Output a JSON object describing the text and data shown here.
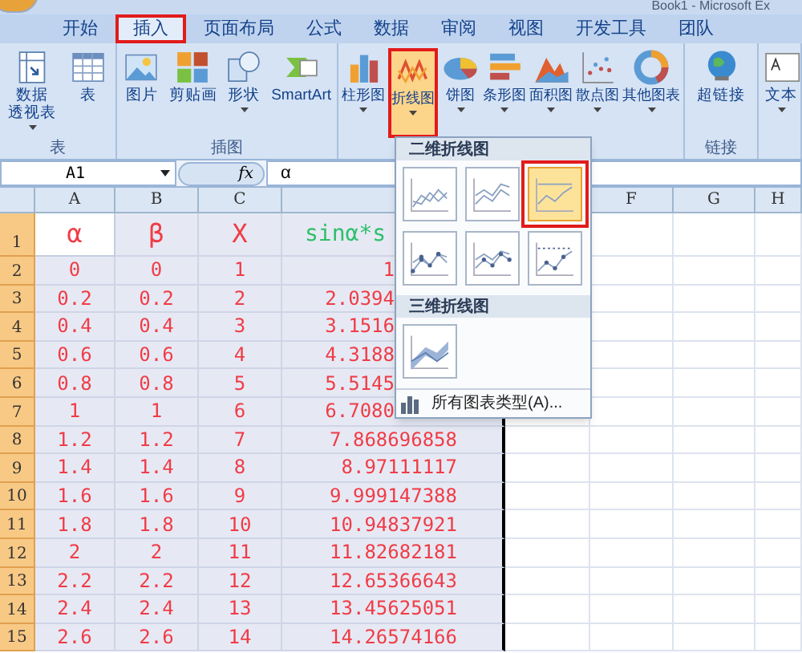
{
  "title_bar": {
    "title": "Book1 - Microsoft Ex"
  },
  "ribbon_tabs": [
    {
      "label": "开始",
      "selected": false
    },
    {
      "label": "插入",
      "selected": true
    },
    {
      "label": "页面布局",
      "selected": false
    },
    {
      "label": "公式",
      "selected": false
    },
    {
      "label": "数据",
      "selected": false
    },
    {
      "label": "审阅",
      "selected": false
    },
    {
      "label": "视图",
      "selected": false
    },
    {
      "label": "开发工具",
      "selected": false
    },
    {
      "label": "团队",
      "selected": false
    }
  ],
  "ribbon_groups": [
    {
      "label": "表",
      "buttons": [
        {
          "kind": "pivot",
          "label": [
            "数据",
            "透视表"
          ],
          "dropdown": true,
          "highlighted": false
        },
        {
          "kind": "table",
          "label": "表",
          "dropdown": false,
          "highlighted": false
        }
      ]
    },
    {
      "label": "插图",
      "buttons": [
        {
          "kind": "picture",
          "label": "图片",
          "dropdown": false,
          "highlighted": false
        },
        {
          "kind": "clipart",
          "label": "剪贴画",
          "dropdown": false,
          "highlighted": false
        },
        {
          "kind": "shapes",
          "label": "形状",
          "dropdown": true,
          "highlighted": false
        },
        {
          "kind": "smartart",
          "label": "SmartArt",
          "dropdown": false,
          "highlighted": false
        }
      ]
    },
    {
      "buttons": [
        {
          "kind": "column",
          "label": "柱形图",
          "dropdown": true,
          "highlighted": false
        },
        {
          "kind": "line",
          "label": "折线图",
          "dropdown": true,
          "highlighted": true
        },
        {
          "kind": "pie",
          "label": "饼图",
          "dropdown": true,
          "highlighted": false
        },
        {
          "kind": "bar",
          "label": "条形图",
          "dropdown": true,
          "highlighted": false
        },
        {
          "kind": "area",
          "label": "面积图",
          "dropdown": true,
          "highlighted": false
        },
        {
          "kind": "scatter",
          "label": "散点图",
          "dropdown": true,
          "highlighted": false
        },
        {
          "kind": "other",
          "label": "其他图表",
          "dropdown": true,
          "highlighted": false
        }
      ]
    },
    {
      "label": "链接",
      "buttons": [
        {
          "kind": "hyperlink",
          "label": "超链接",
          "dropdown": false,
          "highlighted": false
        }
      ]
    },
    {
      "buttons": [
        {
          "kind": "textbox",
          "label": "文本",
          "dropdown": true,
          "highlighted": false
        }
      ]
    }
  ],
  "formula_bar": {
    "name_box": "A1",
    "function_label": "fx",
    "content": "α"
  },
  "sheet": {
    "column_headers": [
      "A",
      "B",
      "C",
      "F",
      "G",
      "H"
    ],
    "rows": [
      {
        "number": "1",
        "selected": true,
        "cells": [
          {
            "text": "α",
            "color": "#f03c46",
            "active": true
          },
          {
            "text": "β",
            "color": "#f03c46",
            "active": false
          },
          {
            "text": "X",
            "color": "#f03c46",
            "active": false
          },
          {
            "text": "sinα*s",
            "color": "#2fbf6a",
            "active": false
          }
        ]
      },
      {
        "number": "2",
        "selected": true,
        "cells": [
          "0",
          "0",
          "1",
          "1"
        ]
      },
      {
        "number": "3",
        "selected": true,
        "cells": [
          "0.2",
          "0.2",
          "2",
          "2.0394"
        ]
      },
      {
        "number": "4",
        "selected": true,
        "cells": [
          "0.4",
          "0.4",
          "3",
          "3.1516"
        ]
      },
      {
        "number": "5",
        "selected": true,
        "cells": [
          "0.6",
          "0.6",
          "4",
          "4.3188"
        ]
      },
      {
        "number": "6",
        "selected": true,
        "cells": [
          "0.8",
          "0.8",
          "5",
          "5.5145"
        ]
      },
      {
        "number": "7",
        "selected": true,
        "cells": [
          "1",
          "1",
          "6",
          "6.7080"
        ]
      },
      {
        "number": "8",
        "selected": true,
        "cells": [
          "1.2",
          "1.2",
          "7",
          "7.868696858"
        ]
      },
      {
        "number": "9",
        "selected": true,
        "cells": [
          "1.4",
          "1.4",
          "8",
          "8.97111117"
        ]
      },
      {
        "number": "10",
        "selected": true,
        "cells": [
          "1.6",
          "1.6",
          "9",
          "9.999147388"
        ]
      },
      {
        "number": "11",
        "selected": true,
        "cells": [
          "1.8",
          "1.8",
          "10",
          "10.94837921"
        ]
      },
      {
        "number": "12",
        "selected": true,
        "cells": [
          "2",
          "2",
          "11",
          "11.82682181"
        ]
      },
      {
        "number": "13",
        "selected": true,
        "cells": [
          "2.2",
          "2.2",
          "12",
          "12.65366643"
        ]
      },
      {
        "number": "14",
        "selected": true,
        "cells": [
          "2.4",
          "2.4",
          "13",
          "13.45625051"
        ]
      },
      {
        "number": "15",
        "selected": true,
        "cells": [
          "2.6",
          "2.6",
          "14",
          "14.26574166"
        ]
      }
    ]
  },
  "line_chart_menu": {
    "sections": [
      {
        "title": "二维折线图",
        "options": [
          {
            "kind": "line",
            "selected": false
          },
          {
            "kind": "stacked",
            "selected": false
          },
          {
            "kind": "percent",
            "selected": true
          },
          {
            "kind": "line-markers",
            "selected": false
          },
          {
            "kind": "stacked-markers",
            "selected": false
          },
          {
            "kind": "percent-markers",
            "selected": false
          }
        ]
      },
      {
        "title": "三维折线图",
        "options": [
          {
            "kind": "line3d",
            "selected": false
          }
        ]
      }
    ],
    "footer": "所有图表类型(A)..."
  }
}
